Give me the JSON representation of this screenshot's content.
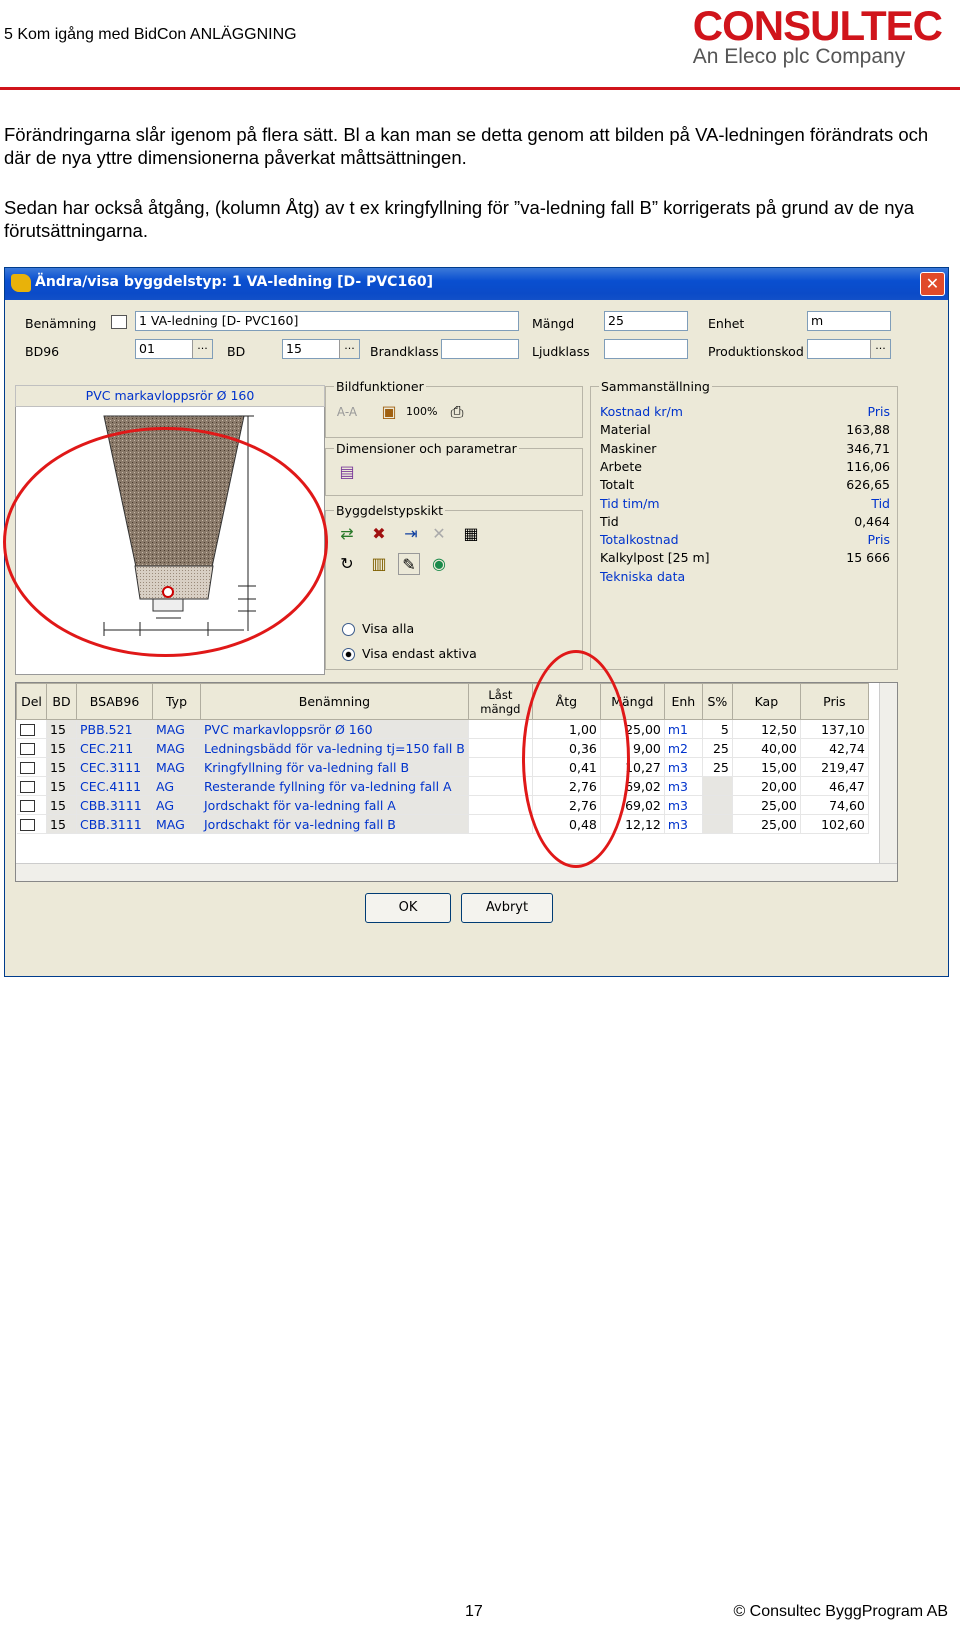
{
  "header": {
    "chapter": "5 Kom igång med BidCon ANLÄGGNING",
    "logo_brand": "CONSULTEC",
    "logo_tagline": "An Eleco plc Company"
  },
  "paragraphs": {
    "p1": "Förändringarna slår igenom på flera sätt. Bl a kan man se detta genom att bilden på VA-ledningen förändrats och där de nya yttre dimensionerna påverkat måttsättningen.",
    "p2": "Sedan har också åtgång, (kolumn Åtg) av t ex kringfyllning för ”va-ledning fall B” korrigerats på grund av de nya förutsättningarna."
  },
  "dialog": {
    "title": "Ändra/visa byggdelstyp: 1 VA-ledning [D- PVC160]",
    "close": "✕",
    "fields": {
      "benamning_label": "Benämning",
      "benamning_value": "1 VA-ledning [D- PVC160]",
      "mangd_label": "Mängd",
      "mangd_value": "25",
      "enhet_label": "Enhet",
      "enhet_value": "m",
      "bd96_label": "BD96",
      "bd96_value": "01",
      "bd_label": "BD",
      "bd_value": "15",
      "brandklass_label": "Brandklass",
      "ljudklass_label": "Ljudklass",
      "produktionskod_label": "Produktionskod",
      "ellipsis": "..."
    },
    "image_caption": "PVC markavloppsrör Ø 160",
    "groups": {
      "bildfunktioner": "Bildfunktioner",
      "zoom": "100%",
      "aa": "A-A",
      "dimensioner": "Dimensioner och parametrar",
      "byggdelstypskikt": "Byggdelstypskikt",
      "visa_alla": "Visa alla",
      "visa_aktiva": "Visa endast aktiva",
      "sammanstallning": "Sammanställning"
    },
    "summary": [
      {
        "k": "Kostnad kr/m",
        "v": "Pris",
        "blue": true
      },
      {
        "k": "Material",
        "v": "163,88",
        "blue": false
      },
      {
        "k": "Maskiner",
        "v": "346,71",
        "blue": false
      },
      {
        "k": "Arbete",
        "v": "116,06",
        "blue": false
      },
      {
        "k": "Totalt",
        "v": "626,65",
        "blue": false
      },
      {
        "k": "Tid tim/m",
        "v": "Tid",
        "blue": true
      },
      {
        "k": "Tid",
        "v": "0,464",
        "blue": false
      },
      {
        "k": "Totalkostnad",
        "v": "Pris",
        "blue": true
      },
      {
        "k": "Kalkylpost [25 m]",
        "v": "15 666",
        "blue": false
      },
      {
        "k": "Tekniska data",
        "v": "",
        "blue": true
      }
    ],
    "table": {
      "headers": [
        "Del",
        "BD",
        "BSAB96",
        "Typ",
        "Benämning",
        "Låst mängd",
        "Åtg",
        "Mängd",
        "Enh",
        "S%",
        "Kap",
        "Pris"
      ],
      "rows": [
        [
          "15",
          "PBB.521",
          "MAG",
          "PVC markavloppsrör Ø 160",
          "",
          "1,00",
          "25,00",
          "m1",
          "5",
          "12,50",
          "137,10"
        ],
        [
          "15",
          "CEC.211",
          "MAG",
          "Ledningsbädd för va-ledning tj=150 fall B",
          "",
          "0,36",
          "9,00",
          "m2",
          "25",
          "40,00",
          "42,74"
        ],
        [
          "15",
          "CEC.3111",
          "MAG",
          "Kringfyllning för va-ledning fall B",
          "",
          "0,41",
          "10,27",
          "m3",
          "25",
          "15,00",
          "219,47"
        ],
        [
          "15",
          "CEC.4111",
          "AG",
          "Resterande fyllning för va-ledning fall A",
          "",
          "2,76",
          "69,02",
          "m3",
          "",
          "20,00",
          "46,47"
        ],
        [
          "15",
          "CBB.3111",
          "AG",
          "Jordschakt för va-ledning fall A",
          "",
          "2,76",
          "69,02",
          "m3",
          "",
          "25,00",
          "74,60"
        ],
        [
          "15",
          "CBB.3111",
          "MAG",
          "Jordschakt för va-ledning fall B",
          "",
          "0,48",
          "12,12",
          "m3",
          "",
          "25,00",
          "102,60"
        ]
      ]
    },
    "buttons": {
      "ok": "OK",
      "cancel": "Avbryt"
    }
  },
  "footer": {
    "page_number": "17",
    "copyright": "© Consultec ByggProgram AB"
  },
  "colors": {
    "accent_red": "#d0141b",
    "title_blue": "#0a4fd0",
    "link_blue": "#0033cc",
    "dialog_bg": "#ece9d8"
  }
}
